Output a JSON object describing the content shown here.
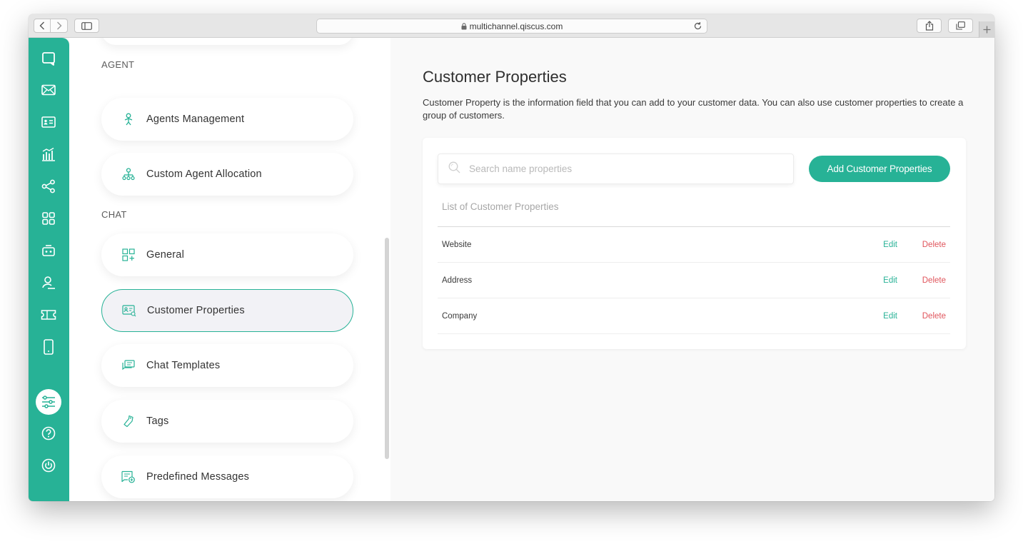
{
  "browser": {
    "url": "multichannel.qiscus.com"
  },
  "settings": {
    "sections": [
      {
        "label": "AGENT",
        "items": [
          {
            "label": "Agents Management",
            "icon": "agent-icon"
          },
          {
            "label": "Custom Agent Allocation",
            "icon": "allocation-icon"
          }
        ]
      },
      {
        "label": "CHAT",
        "items": [
          {
            "label": "General",
            "icon": "grid-plus-icon"
          },
          {
            "label": "Customer Properties",
            "icon": "customer-card-icon",
            "active": true
          },
          {
            "label": "Chat Templates",
            "icon": "chat-template-icon"
          },
          {
            "label": "Tags",
            "icon": "tag-icon"
          },
          {
            "label": "Predefined Messages",
            "icon": "predefined-message-icon"
          }
        ]
      }
    ]
  },
  "main": {
    "title": "Customer Properties",
    "description": "Customer Property is the information field that you can add to your customer data. You can also use customer properties to create a group of customers.",
    "search_placeholder": "Search name properties",
    "add_button": "Add Customer Properties",
    "list_header": "List of Customer Properties",
    "edit_label": "Edit",
    "delete_label": "Delete",
    "properties": [
      {
        "name": "Website"
      },
      {
        "name": "Address"
      },
      {
        "name": "Company"
      }
    ]
  },
  "colors": {
    "accent": "#27b296",
    "delete": "#e0555c"
  }
}
